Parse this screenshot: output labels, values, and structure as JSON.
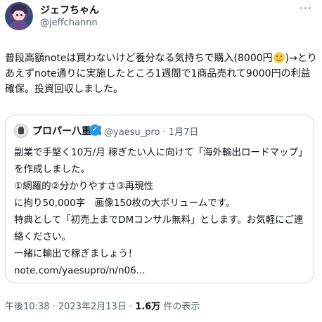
{
  "author": {
    "name": "ジェフちゃん",
    "handle": "@jeffchannn",
    "more_glyph": "···"
  },
  "tweet": {
    "text_part1": "普段高額noteは買わないけど養分なる気持ちで購入(8000円",
    "emoji": "grinning-face-emoji",
    "text_part2": ")→とりあえずnote通りに実施したところ1週間で1商品売れて9000円の利益確保。投資回収しました。"
  },
  "quoted_tweet": {
    "name": "プロパー八重洲",
    "verified_glyph": "✓",
    "handle": "@yaesu_pro",
    "separator": "·",
    "date": "1月7日",
    "body": "副業で手堅く10万/月 稼ぎたい人に向けて「海外輸出ロードマップ」を作成しました。\n①網羅的②分かりやすさ③再現性\nに拘り50,000字　画像150枚の大ボリュームです。\n特典として「初売上までDMコンサル無料」とします。お気軽にご連絡ください。\n一緒に輸出で稼ぎましょう！",
    "link": "note.com/yaesupro/n/n06..."
  },
  "footer": {
    "time": "午後10:38",
    "separator1": " · ",
    "date": "2023年2月13日",
    "separator2": " · ",
    "views_count": "1.6万",
    "views_label": " 件の表示"
  }
}
